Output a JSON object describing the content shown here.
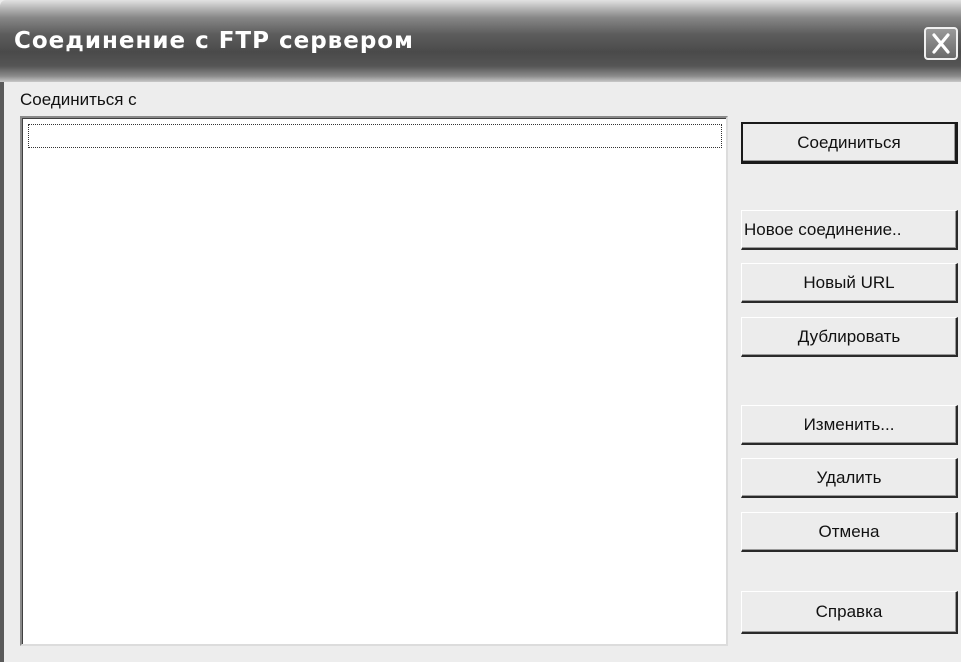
{
  "window": {
    "title": "Соединение с FTP сервером"
  },
  "connect_to": {
    "label": "Соединиться с"
  },
  "connections_list": {
    "items": []
  },
  "buttons": {
    "connect": "Соединиться",
    "new_connection": "Новое соединение..",
    "new_url": "Новый URL",
    "duplicate": "Дублировать",
    "edit": "Изменить...",
    "delete": "Удалить",
    "cancel": "Отмена",
    "help": "Справка"
  },
  "icons": {
    "close": "close-icon"
  }
}
